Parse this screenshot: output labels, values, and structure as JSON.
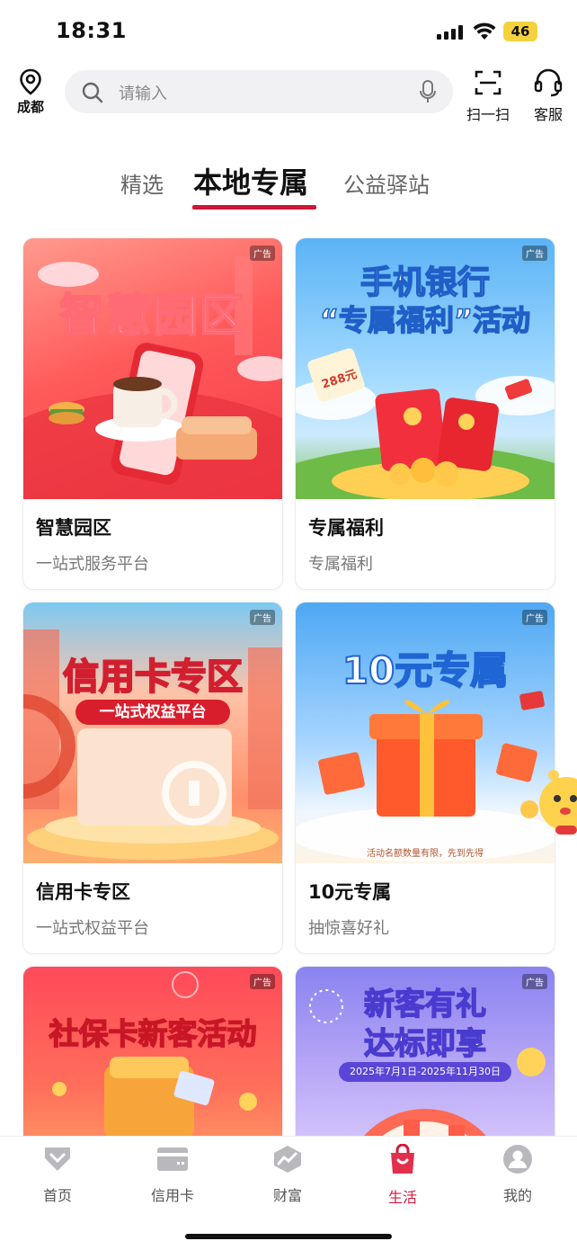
{
  "status_bar": {
    "time": "18:31",
    "battery": "46"
  },
  "top_bar": {
    "location_label": "成都",
    "search_placeholder": "请输入",
    "scan_label": "扫一扫",
    "service_label": "客服"
  },
  "tabs": [
    {
      "label": "精选"
    },
    {
      "label": "本地专属"
    },
    {
      "label": "公益驿站"
    }
  ],
  "ad_badge": "广告",
  "cards": [
    {
      "title": "智慧园区",
      "subtitle": "一站式服务平台",
      "art_title": "智慧园区"
    },
    {
      "title": "专属福利",
      "subtitle": "专属福利",
      "art_title": "手机银行",
      "art_subtitle": "“专属福利”活动",
      "art_badge": "288元"
    },
    {
      "title": "信用卡专区",
      "subtitle": "一站式权益平台",
      "art_title": "信用卡专区",
      "art_subtitle": "一站式权益平台"
    },
    {
      "title": "10元专属",
      "subtitle": "抽惊喜好礼",
      "art_title": "10元专属",
      "art_note": "活动名额数量有限，先到先得"
    },
    {
      "art_title": "社保卡新客活动"
    },
    {
      "art_title": "新客有礼",
      "art_title2": "达标即享",
      "art_subtitle": "2025年7月1日-2025年11月30日"
    }
  ],
  "bottom_nav": [
    {
      "label": "首页",
      "icon": "home-diamond-icon"
    },
    {
      "label": "信用卡",
      "icon": "credit-card-icon"
    },
    {
      "label": "财富",
      "icon": "wealth-chart-icon"
    },
    {
      "label": "生活",
      "icon": "shopping-bag-icon",
      "active": true
    },
    {
      "label": "我的",
      "icon": "profile-icon"
    }
  ],
  "colors": {
    "accent": "#cc1836",
    "active_nav": "#d21a3b"
  }
}
